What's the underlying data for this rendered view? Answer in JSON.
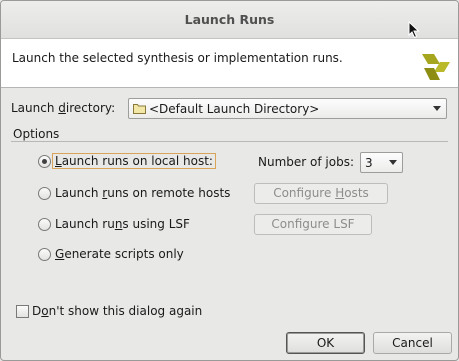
{
  "dialog": {
    "title": "Launch Runs",
    "description": "Launch the selected synthesis or implementation runs."
  },
  "launch_directory": {
    "label_pre": "Launch ",
    "label_mnemonic": "d",
    "label_post": "irectory:",
    "value": "<Default Launch Directory>"
  },
  "options": {
    "label": "Options",
    "radio_local": {
      "mnemonic": "L",
      "rest": "aunch runs on local host:",
      "checked": true
    },
    "radio_remote": {
      "pre": "Launch ",
      "mnemonic": "r",
      "rest": "uns on remote hosts",
      "checked": false
    },
    "radio_lsf": {
      "pre": "Launch ru",
      "mnemonic": "n",
      "rest": "s using LSF",
      "checked": false
    },
    "radio_scripts": {
      "mnemonic": "G",
      "rest": "enerate scripts only",
      "checked": false
    },
    "jobs_label": "Number of jobs:",
    "jobs_value": "3",
    "configure_hosts_pre": "Configure ",
    "configure_hosts_mnemonic": "H",
    "configure_hosts_post": "osts",
    "configure_lsf": "Configure LSF"
  },
  "dont_show": {
    "pre": "D",
    "mnemonic": "o",
    "post": "n't show this dialog again",
    "checked": false
  },
  "buttons": {
    "ok": "OK",
    "cancel": "Cancel"
  },
  "colors": {
    "focus_ring": "#d9a45a",
    "logo": "#a5a51e"
  }
}
